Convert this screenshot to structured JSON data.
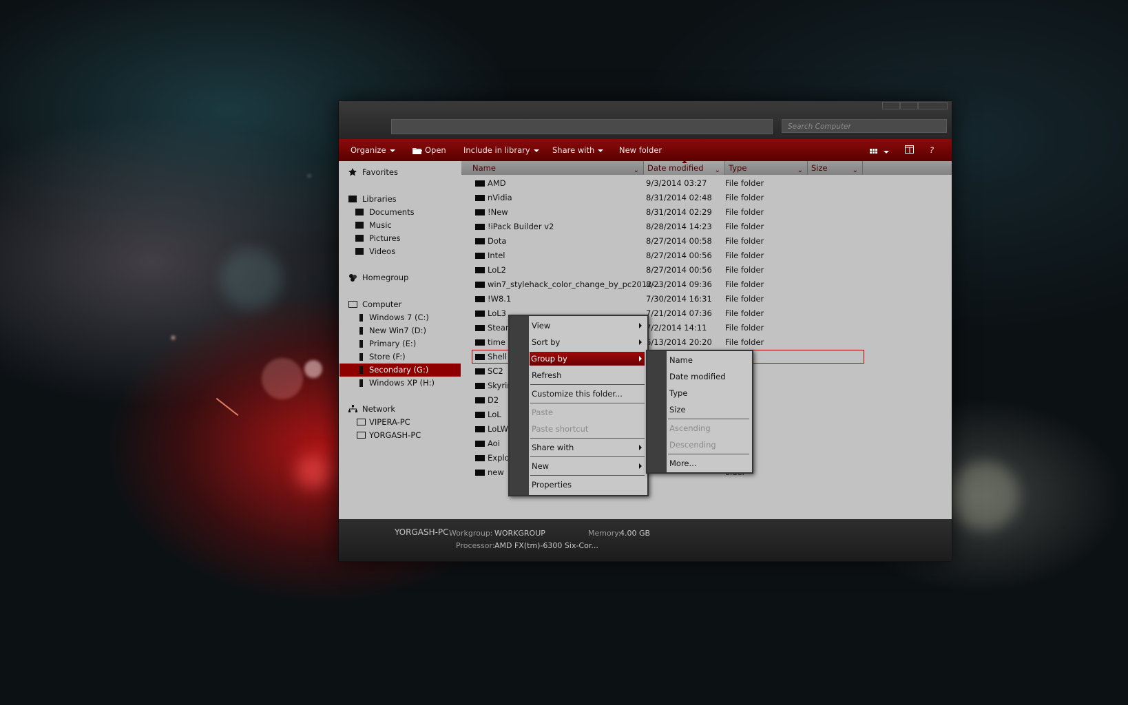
{
  "window": {
    "search_placeholder": "Search Computer"
  },
  "toolbar": {
    "organize": "Organize",
    "open": "Open",
    "include_in_library": "Include in library",
    "share_with": "Share with",
    "new_folder": "New folder",
    "help": "?"
  },
  "nav": {
    "favorites": "Favorites",
    "libraries": "Libraries",
    "documents": "Documents",
    "music": "Music",
    "pictures": "Pictures",
    "videos": "Videos",
    "homegroup": "Homegroup",
    "computer": "Computer",
    "drives": [
      "Windows 7 (C:)",
      "New Win7 (D:)",
      "Primary (E:)",
      "Store (F:)",
      "Secondary (G:)",
      "Windows XP (H:)"
    ],
    "selected": "Secondary (G:)",
    "network": "Network",
    "network_pcs": [
      "VIPERA-PC",
      "YORGASH-PC"
    ]
  },
  "columns": {
    "name": "Name",
    "date": "Date modified",
    "type": "Type",
    "size": "Size"
  },
  "files": [
    {
      "name": "AMD",
      "date": "9/3/2014 03:27",
      "type": "File folder"
    },
    {
      "name": "nVidia",
      "date": "8/31/2014 02:48",
      "type": "File folder"
    },
    {
      "name": "!New",
      "date": "8/31/2014 02:29",
      "type": "File folder"
    },
    {
      "name": "!iPack Builder v2",
      "date": "8/28/2014 14:23",
      "type": "File folder"
    },
    {
      "name": "Dota",
      "date": "8/27/2014 00:58",
      "type": "File folder"
    },
    {
      "name": "Intel",
      "date": "8/27/2014 00:56",
      "type": "File folder"
    },
    {
      "name": "LoL2",
      "date": "8/27/2014 00:56",
      "type": "File folder"
    },
    {
      "name": "win7_stylehack_color_change_by_pc2012-...",
      "date": "8/23/2014 09:36",
      "type": "File folder"
    },
    {
      "name": "!W8.1",
      "date": "7/30/2014 16:31",
      "type": "File folder"
    },
    {
      "name": "LoL3",
      "date": "7/21/2014 07:36",
      "type": "File folder"
    },
    {
      "name": "Steam",
      "date": "7/2/2014 14:11",
      "type": "File folder"
    },
    {
      "name": "time",
      "date": "6/13/2014 20:20",
      "type": "File folder"
    },
    {
      "name": "Shell",
      "date": "",
      "type": "older"
    },
    {
      "name": "SC2",
      "date": "",
      "type": "older"
    },
    {
      "name": "Skyrim",
      "date": "",
      "type": "older"
    },
    {
      "name": "D2",
      "date": "",
      "type": "older"
    },
    {
      "name": "LoL",
      "date": "",
      "type": "older"
    },
    {
      "name": "LoLW8",
      "date": "",
      "type": "older"
    },
    {
      "name": "Aoi",
      "date": "",
      "type": "older"
    },
    {
      "name": "Explor",
      "date": "",
      "type": "older"
    },
    {
      "name": "new",
      "date": "",
      "type": "older"
    }
  ],
  "context_menu": {
    "view": "View",
    "sort_by": "Sort by",
    "group_by": "Group by",
    "refresh": "Refresh",
    "customize": "Customize this folder...",
    "paste": "Paste",
    "paste_shortcut": "Paste shortcut",
    "share_with": "Share with",
    "new": "New",
    "properties": "Properties"
  },
  "submenu": {
    "name": "Name",
    "date_modified": "Date modified",
    "type": "Type",
    "size": "Size",
    "ascending": "Ascending",
    "descending": "Descending",
    "more": "More..."
  },
  "status": {
    "pc_name": "YORGASH-PC",
    "workgroup_label": "Workgroup:",
    "workgroup": "WORKGROUP",
    "memory_label": "Memory:",
    "memory": "4.00 GB",
    "processor_label": "Processor:",
    "processor": "AMD FX(tm)-6300 Six-Cor..."
  },
  "colors": {
    "accent": "#8b0a0a",
    "selection": "#8e0000",
    "panel": "#c2c2c2"
  }
}
